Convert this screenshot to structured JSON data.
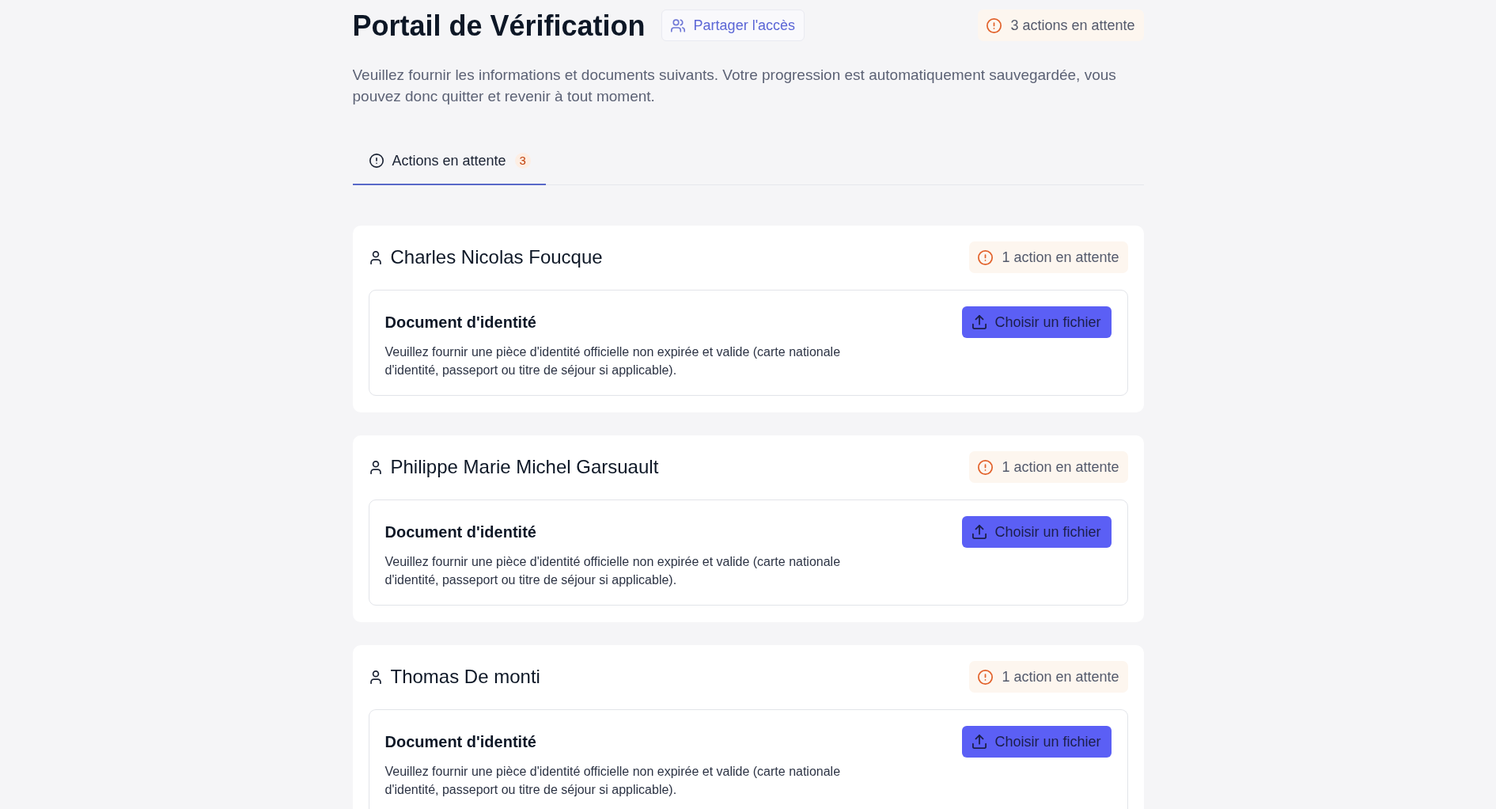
{
  "header": {
    "title": "Portail de Vérification",
    "share_button": "Partager l'accès",
    "pending_badge": "3 actions en attente"
  },
  "intro": "Veuillez fournir les informations et documents suivants. Votre progression est automatiquement sauvegardée, vous pouvez donc quitter et revenir à tout moment.",
  "tabs": [
    {
      "label": "Actions en attente",
      "count": "3",
      "selected": true
    }
  ],
  "persons": [
    {
      "name": "Charles Nicolas Foucque",
      "pending_badge": "1 action en attente",
      "requests": [
        {
          "title": "Document d'identité",
          "description": "Veuillez fournir une pièce d'identité officielle non expirée et valide (carte nationale d'identité, passeport ou titre de séjour si applicable).",
          "button": "Choisir un fichier"
        }
      ]
    },
    {
      "name": "Philippe Marie Michel Garsuault",
      "pending_badge": "1 action en attente",
      "requests": [
        {
          "title": "Document d'identité",
          "description": "Veuillez fournir une pièce d'identité officielle non expirée et valide (carte nationale d'identité, passeport ou titre de séjour si applicable).",
          "button": "Choisir un fichier"
        }
      ]
    },
    {
      "name": "Thomas De monti",
      "pending_badge": "1 action en attente",
      "requests": [
        {
          "title": "Document d'identité",
          "description": "Veuillez fournir une pièce d'identité officielle non expirée et valide (carte nationale d'identité, passeport ou titre de séjour si applicable).",
          "button": "Choisir un fichier"
        }
      ]
    }
  ]
}
